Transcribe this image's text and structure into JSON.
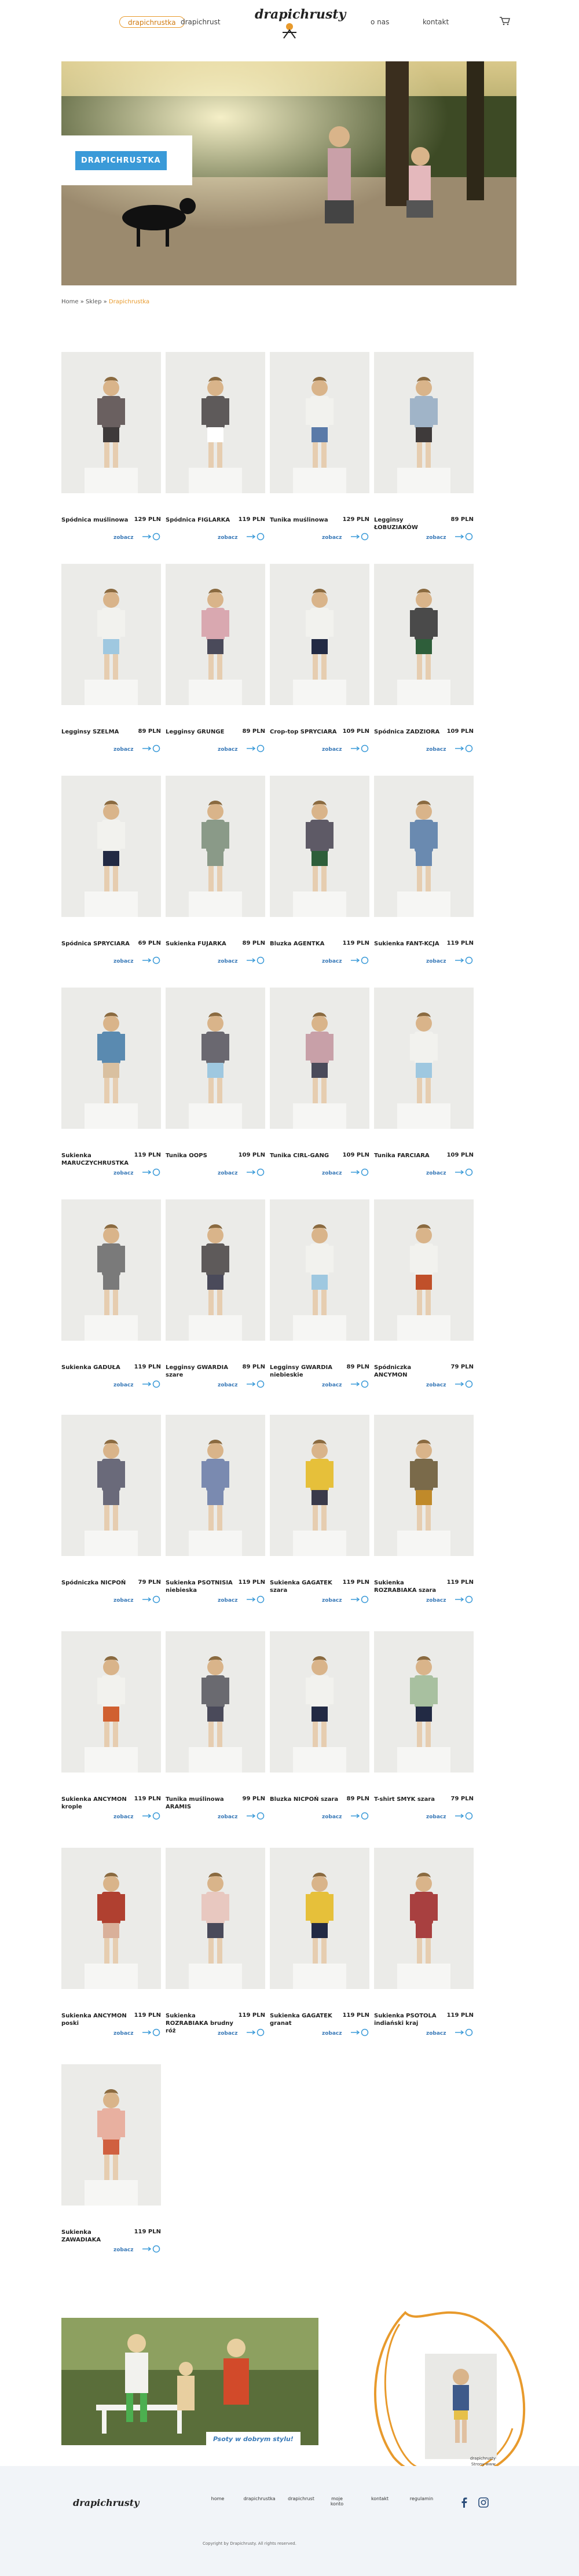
{
  "header": {
    "nav_left": [
      "drapichrustka",
      "drapichrust"
    ],
    "nav_right": [
      "o nas",
      "kontakt"
    ],
    "logo_text": "drapichrusty"
  },
  "hero": {
    "label": "DRAPICHRUSTKA"
  },
  "breadcrumb": {
    "home": "Home",
    "sep1": " » ",
    "shop": "Sklep",
    "sep2": " » ",
    "current": "Drapichrustka"
  },
  "products": [
    {
      "name": "Spódnica muślinowa",
      "price": "129 PLN",
      "more": "zobacz"
    },
    {
      "name": "Spódnica FIGLARKA",
      "price": "119 PLN",
      "more": "zobacz"
    },
    {
      "name": "Tunika muślinowa",
      "price": "129 PLN",
      "more": "zobacz"
    },
    {
      "name": "Legginsy ŁOBUZIAKÓW",
      "price": "89 PLN",
      "more": "zobacz"
    },
    {
      "name": "Legginsy SZELMA",
      "price": "89 PLN",
      "more": "zobacz"
    },
    {
      "name": "Legginsy GRUNGE",
      "price": "89 PLN",
      "more": "zobacz"
    },
    {
      "name": "Crop-top SPRYCIARA",
      "price": "109 PLN",
      "more": "zobacz"
    },
    {
      "name": "Spódnica ZADZIORA",
      "price": "109 PLN",
      "more": "zobacz"
    },
    {
      "name": "Spódnica SPRYCIARA",
      "price": "69 PLN",
      "more": "zobacz"
    },
    {
      "name": "Sukienka FUJARKA",
      "price": "89 PLN",
      "more": "zobacz"
    },
    {
      "name": "Bluzka AGENTKA",
      "price": "119 PLN",
      "more": "zobacz"
    },
    {
      "name": "Sukienka FANT-KCJA",
      "price": "119 PLN",
      "more": "zobacz"
    },
    {
      "name": "Sukienka MARUCZYCHRUSTKA",
      "price": "119 PLN",
      "more": "zobacz"
    },
    {
      "name": "Tunika OOPS",
      "price": "109 PLN",
      "more": "zobacz"
    },
    {
      "name": "Tunika CIRL-GANG",
      "price": "109 PLN",
      "more": "zobacz"
    },
    {
      "name": "Tunika FARCIARA",
      "price": "109 PLN",
      "more": "zobacz"
    },
    {
      "name": "Sukienka GADUŁA",
      "price": "119 PLN",
      "more": "zobacz"
    },
    {
      "name": "Legginsy GWARDIA szare",
      "price": "89 PLN",
      "more": "zobacz"
    },
    {
      "name": "Legginsy GWARDIA niebieskie",
      "price": "89 PLN",
      "more": "zobacz"
    },
    {
      "name": "Spódniczka ANCYMON",
      "price": "79 PLN",
      "more": "zobacz"
    },
    {
      "name": "Spódniczka NICPOŃ",
      "price": "79 PLN",
      "more": "zobacz"
    },
    {
      "name": "Sukienka PSOTNISIA niebieska",
      "price": "119 PLN",
      "more": "zobacz"
    },
    {
      "name": "Sukienka GAGATEK szara",
      "price": "119 PLN",
      "more": "zobacz"
    },
    {
      "name": "Sukienka ROZRABIAKA szara",
      "price": "119 PLN",
      "more": "zobacz"
    },
    {
      "name": "Sukienka ANCYMON krople",
      "price": "119 PLN",
      "more": "zobacz"
    },
    {
      "name": "Tunika muślinowa ARAMIS",
      "price": "99 PLN",
      "more": "zobacz"
    },
    {
      "name": "Bluzka NICPOŃ szara",
      "price": "89 PLN",
      "more": "zobacz"
    },
    {
      "name": "T-shirt SMYK szara",
      "price": "79 PLN",
      "more": "zobacz"
    },
    {
      "name": "Sukienka ANCYMON poski",
      "price": "119 PLN",
      "more": "zobacz"
    },
    {
      "name": "Sukienka ROZRABIAKA brudny róż",
      "price": "119 PLN",
      "more": "zobacz"
    },
    {
      "name": "Sukienka GAGATEK granat",
      "price": "119 PLN",
      "more": "zobacz"
    },
    {
      "name": "Sukienka PSOTOLA indiański kraj",
      "price": "119 PLN",
      "more": "zobacz"
    },
    {
      "name": "Sukienka ZAWADIAKA",
      "price": "119 PLN",
      "more": "zobacz"
    }
  ],
  "bottom_banner": "Psoty w dobrym stylu!",
  "footer": {
    "logo_text": "drapichrusty",
    "links": [
      "home",
      "drapichrustka",
      "drapichrust",
      "moje konto",
      "kontakt",
      "regulamin"
    ],
    "copyright": "Copyright by Drapichrusty. All rights reserved.",
    "contact_1": "drapichrusty",
    "contact_2": "Strony www"
  },
  "colors": {
    "accent": "#e89a2c",
    "blue": "#3a9ad8",
    "link": "#3a7ab8"
  }
}
